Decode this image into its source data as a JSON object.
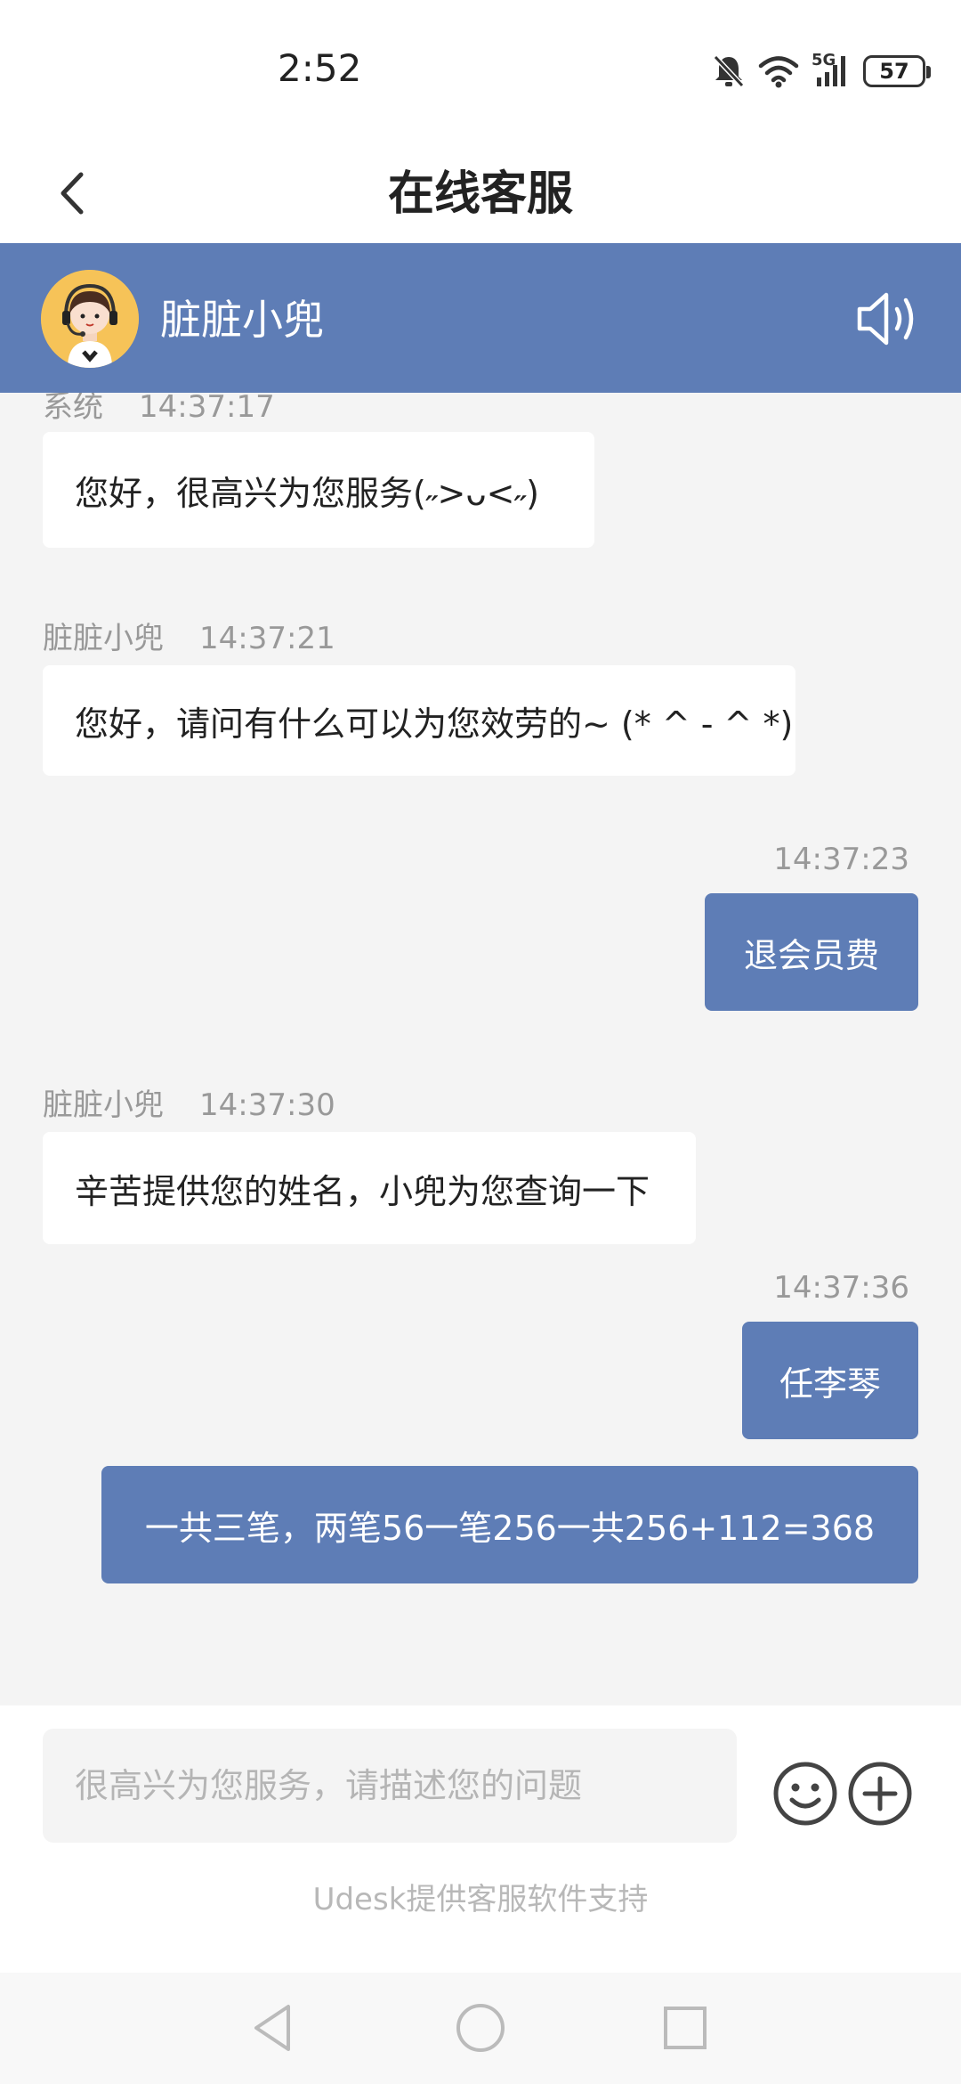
{
  "status_bar": {
    "time": "2:52",
    "network": "5G",
    "battery": "57"
  },
  "header": {
    "title": "在线客服",
    "back_icon": "chevron-left-icon"
  },
  "agent_bar": {
    "name": "脏脏小兜",
    "avatar_icon": "customer-service-avatar",
    "speaker_icon": "speaker-icon",
    "color": "#5e7db6"
  },
  "messages": [
    {
      "side": "left",
      "sender": "系统",
      "time": "14:37:17",
      "text": "您好，很高兴为您服务(˶>ᴗ<˶)"
    },
    {
      "side": "left",
      "sender": "脏脏小兜",
      "time": "14:37:21",
      "text": "您好，请问有什么可以为您效劳的~ (* ^ - ^ *)"
    },
    {
      "side": "right",
      "time": "14:37:23",
      "text": "退会员费"
    },
    {
      "side": "left",
      "sender": "脏脏小兜",
      "time": "14:37:30",
      "text": "辛苦提供您的姓名，小兜为您查询一下"
    },
    {
      "side": "right",
      "time": "14:37:36",
      "text": "任李琴"
    },
    {
      "side": "right",
      "text": "一共三笔，两笔56一笔256一共256+112=368"
    }
  ],
  "input": {
    "placeholder": "很高兴为您服务，请描述您的问题",
    "value": "",
    "emoji_icon": "smiley-icon",
    "add_icon": "plus-circle-icon"
  },
  "footer": {
    "powered_by": "Udesk提供客服软件支持"
  },
  "nav_bar": {
    "back_icon": "triangle-back-icon",
    "home_icon": "circle-home-icon",
    "recents_icon": "square-recents-icon"
  }
}
